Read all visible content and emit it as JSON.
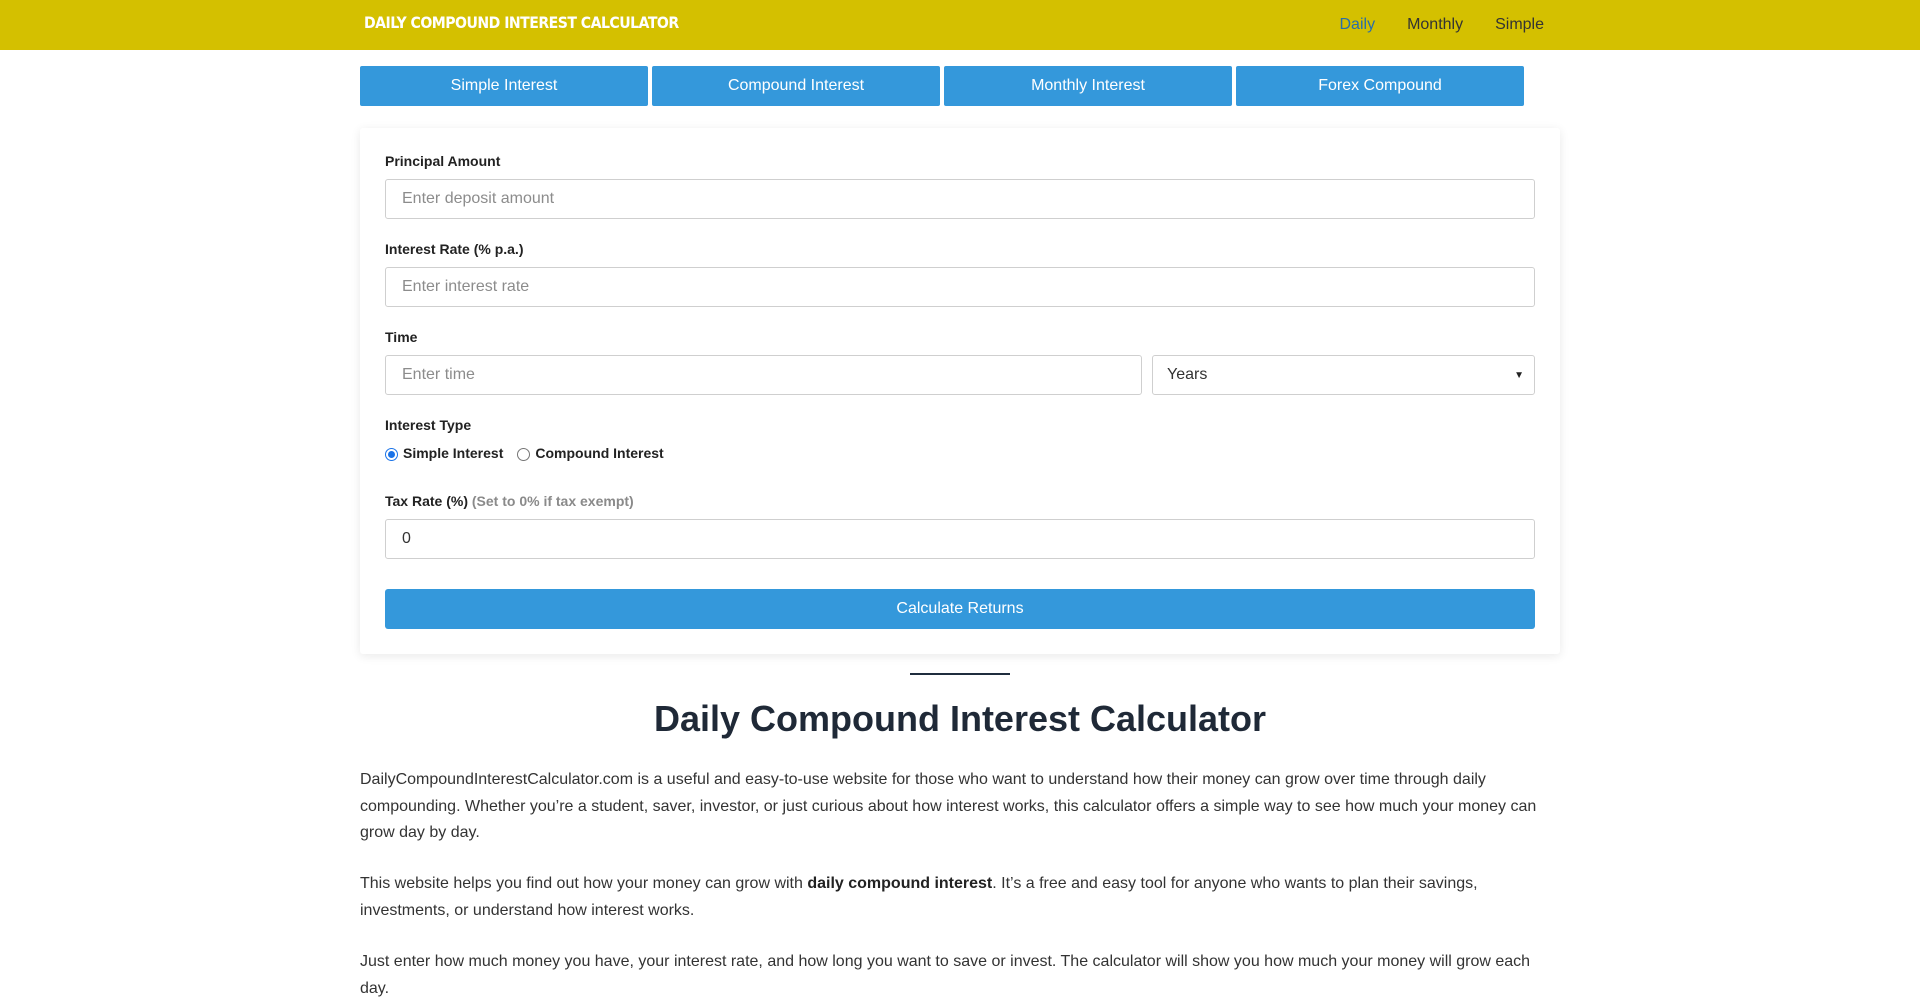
{
  "header": {
    "brand": "DAILY COMPOUND INTEREST CALCULATOR",
    "nav": [
      "Daily",
      "Monthly",
      "Simple"
    ],
    "active_nav": "Daily",
    "bg_color": "#d4c000"
  },
  "tabs": [
    "Simple Interest",
    "Compound Interest",
    "Monthly Interest",
    "Forex Compound"
  ],
  "form": {
    "principal_label": "Principal Amount",
    "principal_placeholder": "Enter deposit amount",
    "rate_label": "Interest Rate (% p.a.)",
    "rate_placeholder": "Enter interest rate",
    "time_label": "Time",
    "time_placeholder": "Enter time",
    "time_unit": "Years",
    "interest_type_label": "Interest Type",
    "interest_options": [
      "Simple Interest",
      "Compound Interest"
    ],
    "interest_selected": "Simple Interest",
    "tax_label": "Tax Rate (%)",
    "tax_hint": "(Set to 0% if tax exempt)",
    "tax_value": "0",
    "calculate_label": "Calculate Returns",
    "accent_color": "#3498db"
  },
  "article": {
    "heading": "Daily Compound Interest Calculator",
    "p1": "DailyCompoundInterestCalculator.com is a useful and easy-to-use website for those who want to understand how their money can grow over time through daily compounding. Whether you’re a student, saver, investor, or just curious about how interest works, this calculator offers a simple way to see how much your money can grow day by day.",
    "p2_before": "This website helps you find out how your money can grow with ",
    "p2_bold": "daily compound interest",
    "p2_after": ". It’s a free and easy tool for anyone who wants to plan their savings, investments, or understand how interest works.",
    "p3": "Just enter how much money you have, your interest rate, and how long you want to save or invest. The calculator will show you how much your money will grow each day."
  }
}
